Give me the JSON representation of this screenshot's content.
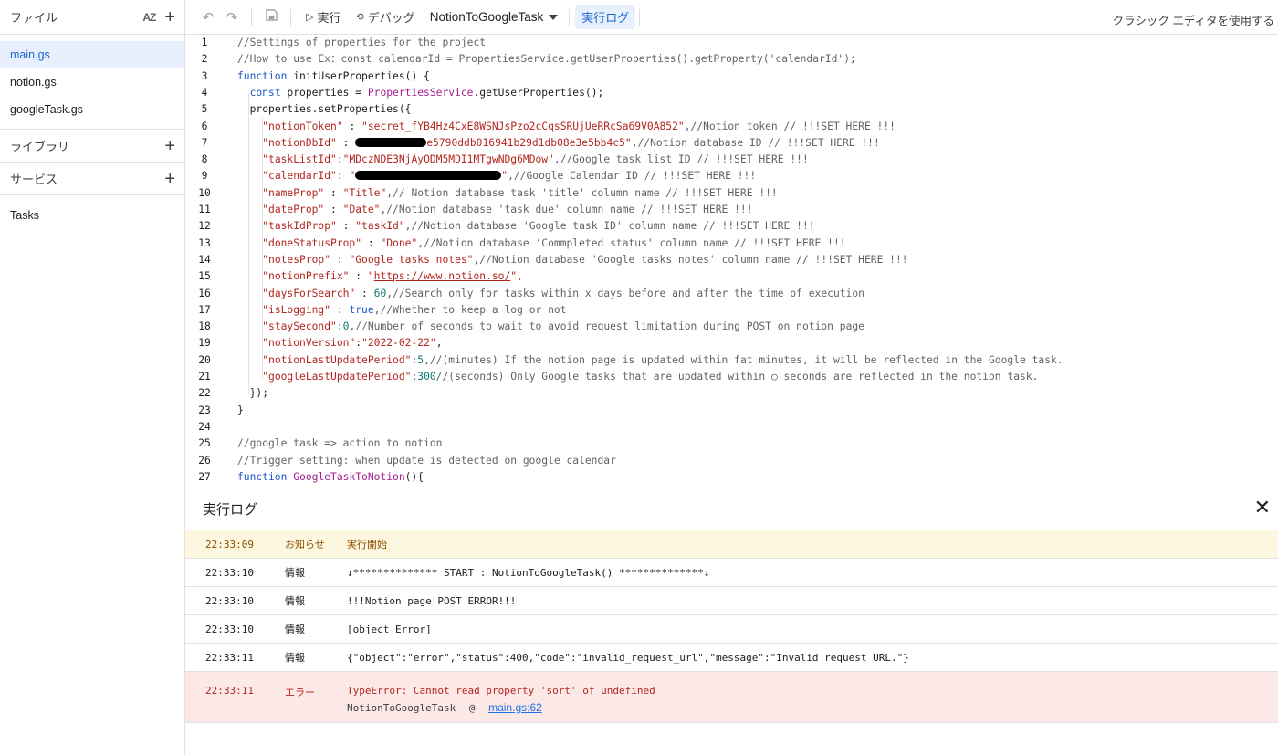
{
  "sidebar": {
    "files_title": "ファイル",
    "sort_label": "AZ",
    "files": [
      {
        "name": "main.gs",
        "active": true
      },
      {
        "name": "notion.gs",
        "active": false
      },
      {
        "name": "googleTask.gs",
        "active": false
      }
    ],
    "libraries_title": "ライブラリ",
    "services_title": "サービス",
    "tasks_item": "Tasks"
  },
  "toolbar": {
    "run_label": "実行",
    "debug_label": "デバッグ",
    "function_name": "NotionToGoogleTask",
    "exec_log_label": "実行ログ",
    "classic_editor_label": "クラシック エディタを使用する"
  },
  "editor": {
    "line_numbers": [
      "1",
      "2",
      "3",
      "4",
      "5",
      "6",
      "7",
      "8",
      "9",
      "10",
      "11",
      "12",
      "13",
      "14",
      "15",
      "16",
      "17",
      "18",
      "19",
      "20",
      "21",
      "22",
      "23",
      "24",
      "25",
      "26",
      "27"
    ],
    "lines": {
      "l1": "//Settings of properties for the project",
      "l2": "//How to use Ex：const calendarId = PropertiesService.getUserProperties().getProperty('calendarId');",
      "l3_kw": "function",
      "l3_rest": " initUserProperties() {",
      "l4_kw": "const",
      "l4_mid": " properties = ",
      "l4_cls": "PropertiesService",
      "l4_rest": ".getUserProperties();",
      "l5": "properties.setProperties({",
      "l6_key": "\"notionToken\"",
      "l6_val": "\"secret_fYB4Hz4CxE8WSNJsPzo2cCqsSRUjUeRRcSa69V0A852\"",
      "l6_cmt": ",//Notion token // !!!SET HERE !!!",
      "l7_key": "\"notionDbId\"",
      "l7_val": "e5790ddb016941b29d1db08e3e5bb4c5\"",
      "l7_cmt": ",//Notion database ID // !!!SET HERE !!!",
      "l8_key": "\"taskListId\"",
      "l8_val": "\"MDczNDE3NjAyODM5MDI1MTgwNDg6MDow\"",
      "l8_cmt": ",//Google task list ID // !!!SET HERE !!!",
      "l9_key": "\"calendarId\"",
      "l9_val": "\"",
      "l9_val2": "\"",
      "l9_cmt": ",//Google Calendar ID // !!!SET HERE !!!",
      "l10_key": "\"nameProp\"",
      "l10_val": "\"Title\"",
      "l10_cmt": ",// Notion database task 'title' column name // !!!SET HERE !!!",
      "l11_key": "\"dateProp\"",
      "l11_val": "\"Date\"",
      "l11_cmt": ",//Notion database 'task due' column name // !!!SET HERE !!!",
      "l12_key": "\"taskIdProp\"",
      "l12_val": "\"taskId\"",
      "l12_cmt": ",//Notion database 'Google task ID' column name // !!!SET HERE !!!",
      "l13_key": "\"doneStatusProp\"",
      "l13_val": "\"Done\"",
      "l13_cmt": ",//Notion database 'Commpleted status' column name // !!!SET HERE !!!",
      "l14_key": "\"notesProp\"",
      "l14_val": "\"Google tasks notes\"",
      "l14_cmt": ",//Notion database 'Google tasks notes' column name // !!!SET HERE !!!",
      "l15_key": "\"notionPrefix\"",
      "l15_q": "\"",
      "l15_url": "https://www.notion.so/",
      "l15_end": "\",",
      "l16_key": "\"daysForSearch\"",
      "l16_val": "60",
      "l16_cmt": ",//Search only for tasks within x days before and after the time of execution",
      "l17_key": "\"isLogging\"",
      "l17_val": "true",
      "l17_cmt": ",//Whether to keep a log or not",
      "l18_key": "\"staySecond\"",
      "l18_val": "0",
      "l18_cmt": ",//Number of seconds to wait to avoid request limitation during POST on notion page",
      "l19_key": "\"notionVersion\"",
      "l19_val": "\"2022-02-22\"",
      "l19_end": ",",
      "l20_key": "\"notionLastUpdatePeriod\"",
      "l20_val": "5",
      "l20_cmt": ",//(minutes) If the notion page is updated within fat minutes, it will be reflected in the Google task.",
      "l21_key": "\"googleLastUpdatePeriod\"",
      "l21_val": "300",
      "l21_cmt": "//(seconds) Only Google tasks that are updated within ○ seconds are reflected in the notion task.",
      "l22": "});",
      "l23": "}",
      "l25": "//google task => action to notion",
      "l26": "//Trigger setting: when update is detected on google calendar",
      "l27_kw": "function",
      "l27_fn": "GoogleTaskToNotion",
      "l27_rest": "(){"
    }
  },
  "log": {
    "title": "実行ログ",
    "rows": [
      {
        "time": "22:33:09",
        "level": "お知らせ",
        "message": "実行開始"
      },
      {
        "time": "22:33:10",
        "level": "情報",
        "message": "↓************** START : NotionToGoogleTask()  **************↓"
      },
      {
        "time": "22:33:10",
        "level": "情報",
        "message": "!!!Notion page POST ERROR!!!"
      },
      {
        "time": "22:33:10",
        "level": "情報",
        "message": "[object Error]"
      },
      {
        "time": "22:33:11",
        "level": "情報",
        "message": "{\"object\":\"error\",\"status\":400,\"code\":\"invalid_request_url\",\"message\":\"Invalid request URL.\"}"
      }
    ],
    "error": {
      "time": "22:33:11",
      "level": "エラー",
      "message": "TypeError: Cannot read property 'sort' of undefined",
      "trace_fn": "NotionToGoogleTask",
      "trace_at": "@",
      "trace_link": "main.gs:62"
    }
  },
  "colors": {
    "active_file_bg": "#e8f0fe",
    "accent": "#1967d2",
    "notice_bg": "#fef7e0",
    "error_bg": "#fce8e6",
    "error_text": "#b3261e"
  },
  "icons": [
    "sort-az-icon",
    "plus-icon",
    "undo-icon",
    "redo-icon",
    "save-icon",
    "play-icon",
    "debug-icon",
    "chevron-down-icon",
    "close-icon"
  ]
}
